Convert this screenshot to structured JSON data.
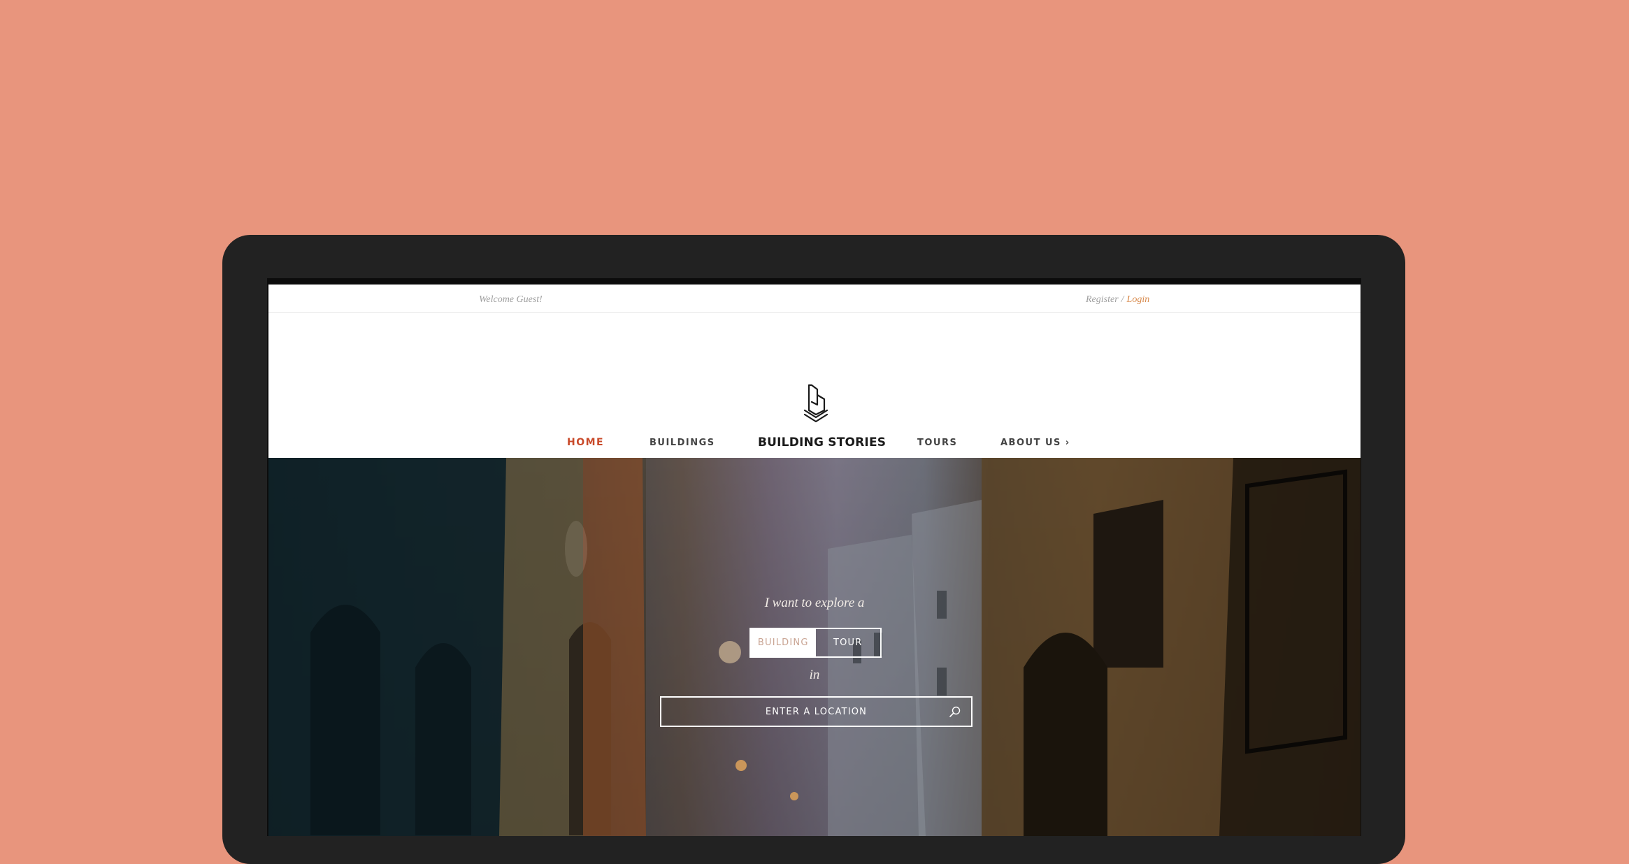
{
  "topbar": {
    "welcome": "Welcome Guest!",
    "register": "Register",
    "separator": "/",
    "login": "Login"
  },
  "brand": {
    "name": "BUILDING STORIES",
    "logo_icon": "building-stories-logo-icon"
  },
  "nav": {
    "items": [
      "HOME",
      "BUILDINGS",
      "TOURS",
      "ABOUT US ›"
    ],
    "active": "HOME"
  },
  "hero": {
    "lead": "I want to explore a",
    "options": [
      "BUILDING",
      "TOUR"
    ],
    "selected": "BUILDING",
    "connector": "in",
    "search_placeholder": "ENTER A LOCATION",
    "search_icon": "search-icon"
  },
  "colors": {
    "background": "#e8957d",
    "device_frame": "#222222",
    "accent_active": "#c94a2a",
    "login_link": "#d88a4c"
  }
}
